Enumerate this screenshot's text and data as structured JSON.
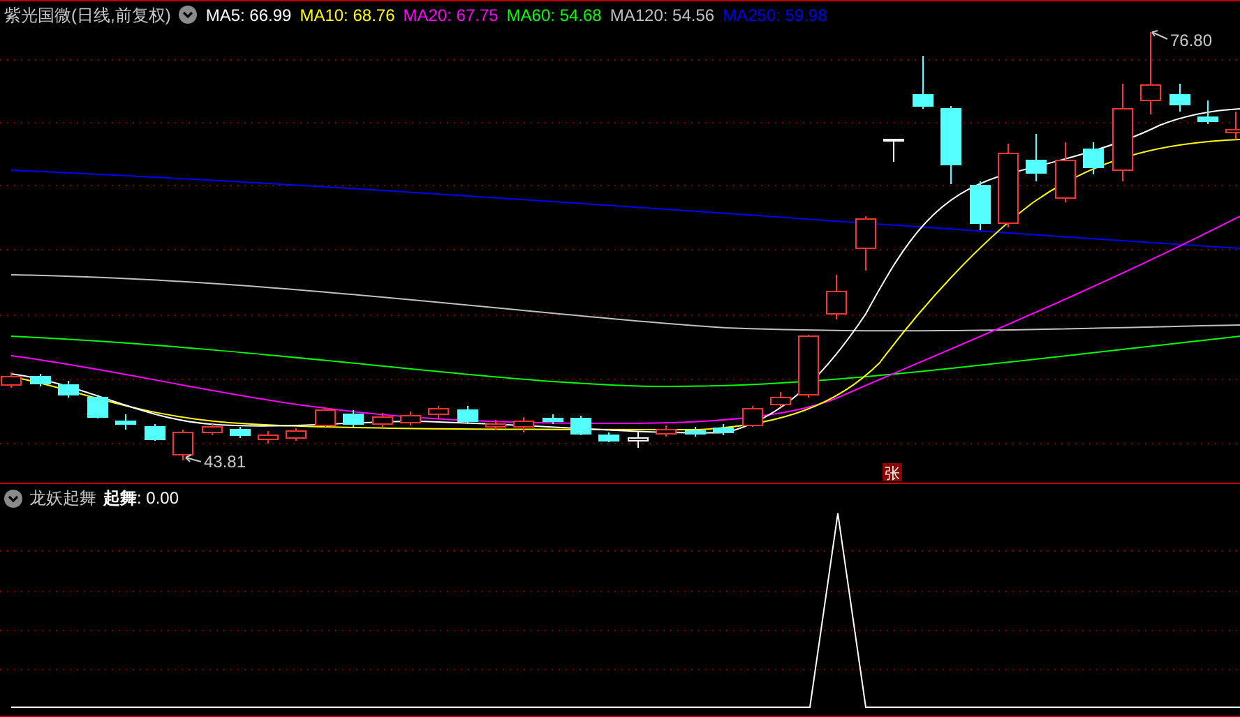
{
  "header": {
    "title": "紫光国微(日线,前复权)",
    "legend": [
      {
        "text": "MA5: 66.99",
        "color": "#ffffff"
      },
      {
        "text": "MA10: 68.76",
        "color": "#ffff00"
      },
      {
        "text": "MA20: 67.75",
        "color": "#ff00ff"
      },
      {
        "text": "MA60: 54.68",
        "color": "#00ff00"
      },
      {
        "text": "MA120: 54.56",
        "color": "#c0c0c0"
      },
      {
        "text": "MA250: 59.98",
        "color": "#0000ff"
      }
    ]
  },
  "price_chart": {
    "high_label": "76.80",
    "low_label": "43.81",
    "badge": "张"
  },
  "indicator": {
    "name": "龙妖起舞",
    "reading": "**起舞**: 0.00"
  }
}
